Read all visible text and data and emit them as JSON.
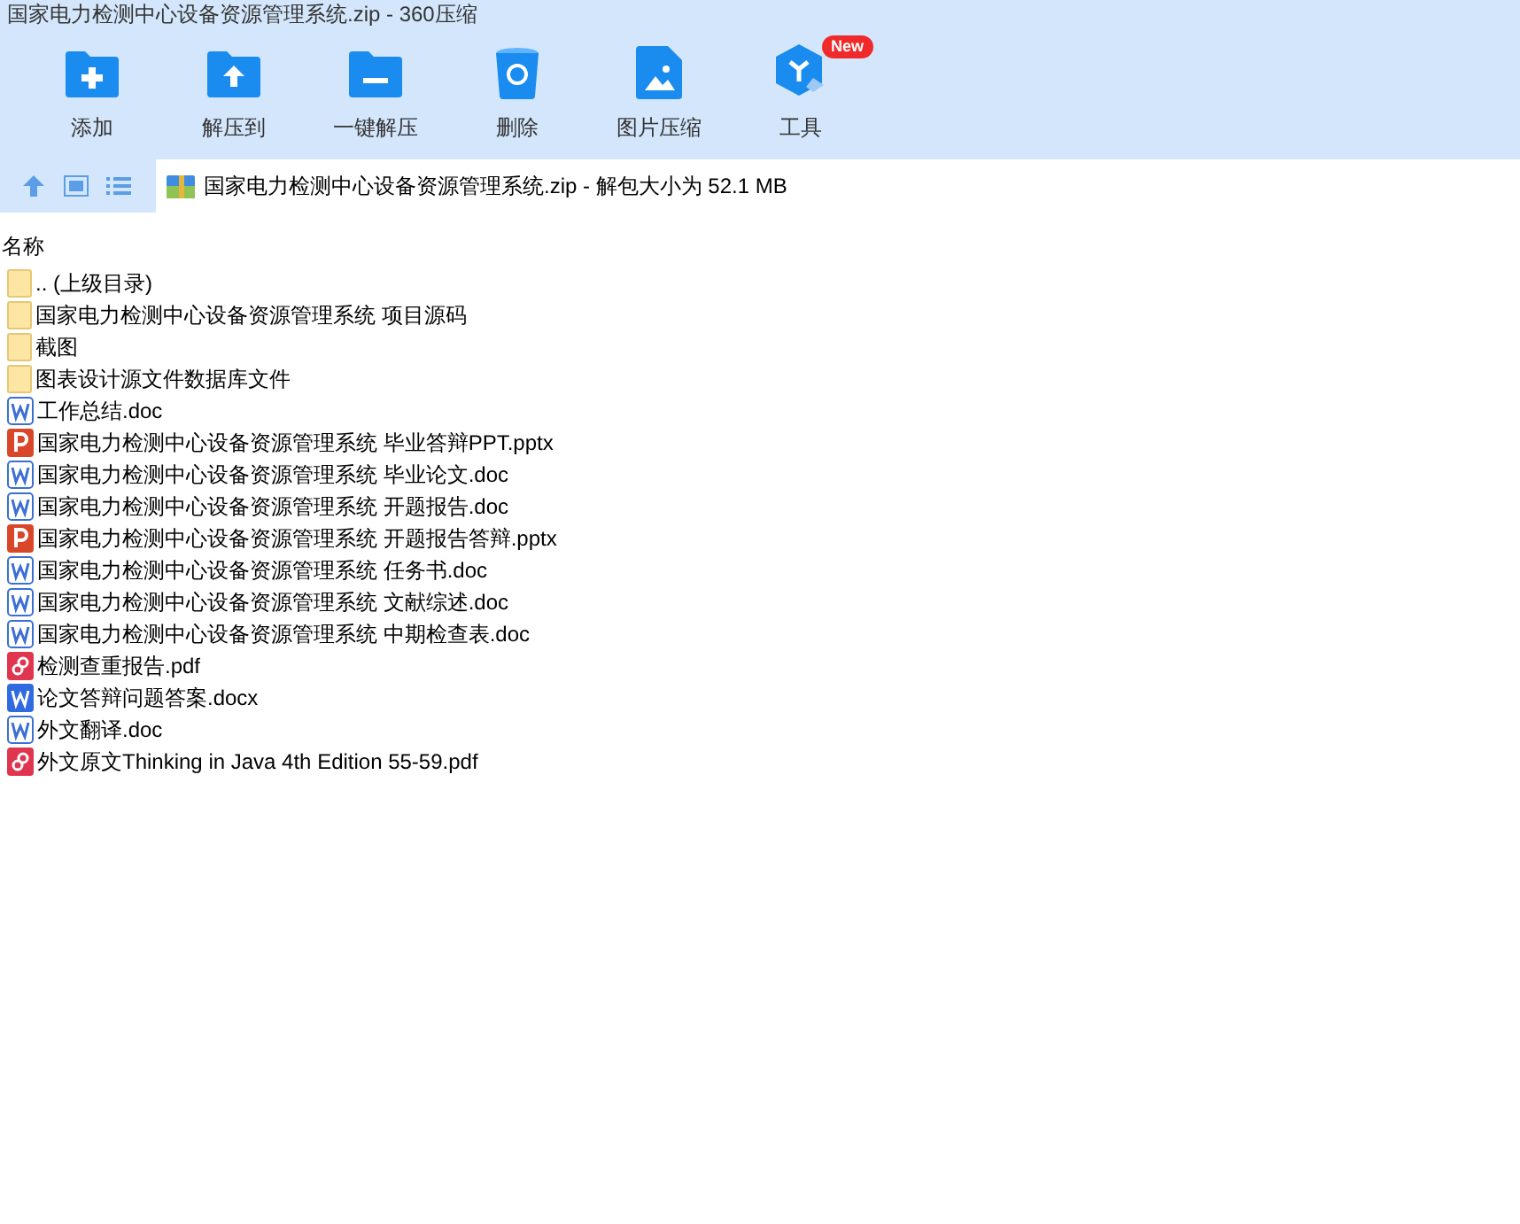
{
  "window": {
    "title": "国家电力检测中心设备资源管理系统.zip - 360压缩"
  },
  "toolbar": [
    {
      "kind": "add",
      "label": "添加"
    },
    {
      "kind": "extract",
      "label": "解压到"
    },
    {
      "kind": "oneclick",
      "label": "一键解压"
    },
    {
      "kind": "delete",
      "label": "删除"
    },
    {
      "kind": "image",
      "label": "图片压缩"
    },
    {
      "kind": "tools",
      "label": "工具",
      "badge": "New"
    }
  ],
  "path": "国家电力检测中心设备资源管理系统.zip - 解包大小为 52.1 MB",
  "columns": [
    "名称"
  ],
  "files": [
    {
      "kind": "folder",
      "name": ".. (上级目录)"
    },
    {
      "kind": "folder",
      "name": "国家电力检测中心设备资源管理系统 项目源码"
    },
    {
      "kind": "folder",
      "name": "截图"
    },
    {
      "kind": "folder",
      "name": "图表设计源文件数据库文件"
    },
    {
      "kind": "doc",
      "name": "工作总结.doc"
    },
    {
      "kind": "ppt",
      "name": "国家电力检测中心设备资源管理系统 毕业答辩PPT.pptx"
    },
    {
      "kind": "doc",
      "name": "国家电力检测中心设备资源管理系统 毕业论文.doc"
    },
    {
      "kind": "doc",
      "name": "国家电力检测中心设备资源管理系统 开题报告.doc"
    },
    {
      "kind": "ppt",
      "name": "国家电力检测中心设备资源管理系统 开题报告答辩.pptx"
    },
    {
      "kind": "doc",
      "name": "国家电力检测中心设备资源管理系统 任务书.doc"
    },
    {
      "kind": "doc",
      "name": "国家电力检测中心设备资源管理系统 文献综述.doc"
    },
    {
      "kind": "doc",
      "name": "国家电力检测中心设备资源管理系统 中期检查表.doc"
    },
    {
      "kind": "pdf",
      "name": "检测查重报告.pdf"
    },
    {
      "kind": "docx",
      "name": "论文答辩问题答案.docx"
    },
    {
      "kind": "doc",
      "name": "外文翻译.doc"
    },
    {
      "kind": "pdf",
      "name": "外文原文Thinking in Java 4th Edition 55-59.pdf"
    }
  ]
}
